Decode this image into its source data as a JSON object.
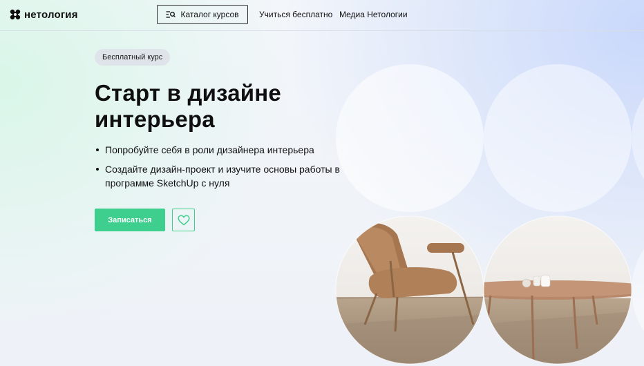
{
  "header": {
    "logo_text": "нетология",
    "catalog_label": "Каталог курсов",
    "nav_links": [
      "Учиться бесплатно",
      "Медиа Нетологии"
    ]
  },
  "hero": {
    "badge": "Бесплатный курс",
    "title_line1": "Старт в дизайне",
    "title_line2": "интерьера",
    "bullets": [
      "Попробуйте себя в роли дизайнера интерьера",
      "Создайте дизайн-проект и изучите основы работы в программе SketchUp с нуля"
    ],
    "signup_label": "Записаться"
  },
  "colors": {
    "accent": "#3ecf8e",
    "text": "#0f0f10",
    "badge_bg": "#dfe4ea"
  },
  "icons": {
    "logo": "netology-logo-icon",
    "catalog": "catalog-list-search-icon",
    "favorite": "heart-icon"
  }
}
